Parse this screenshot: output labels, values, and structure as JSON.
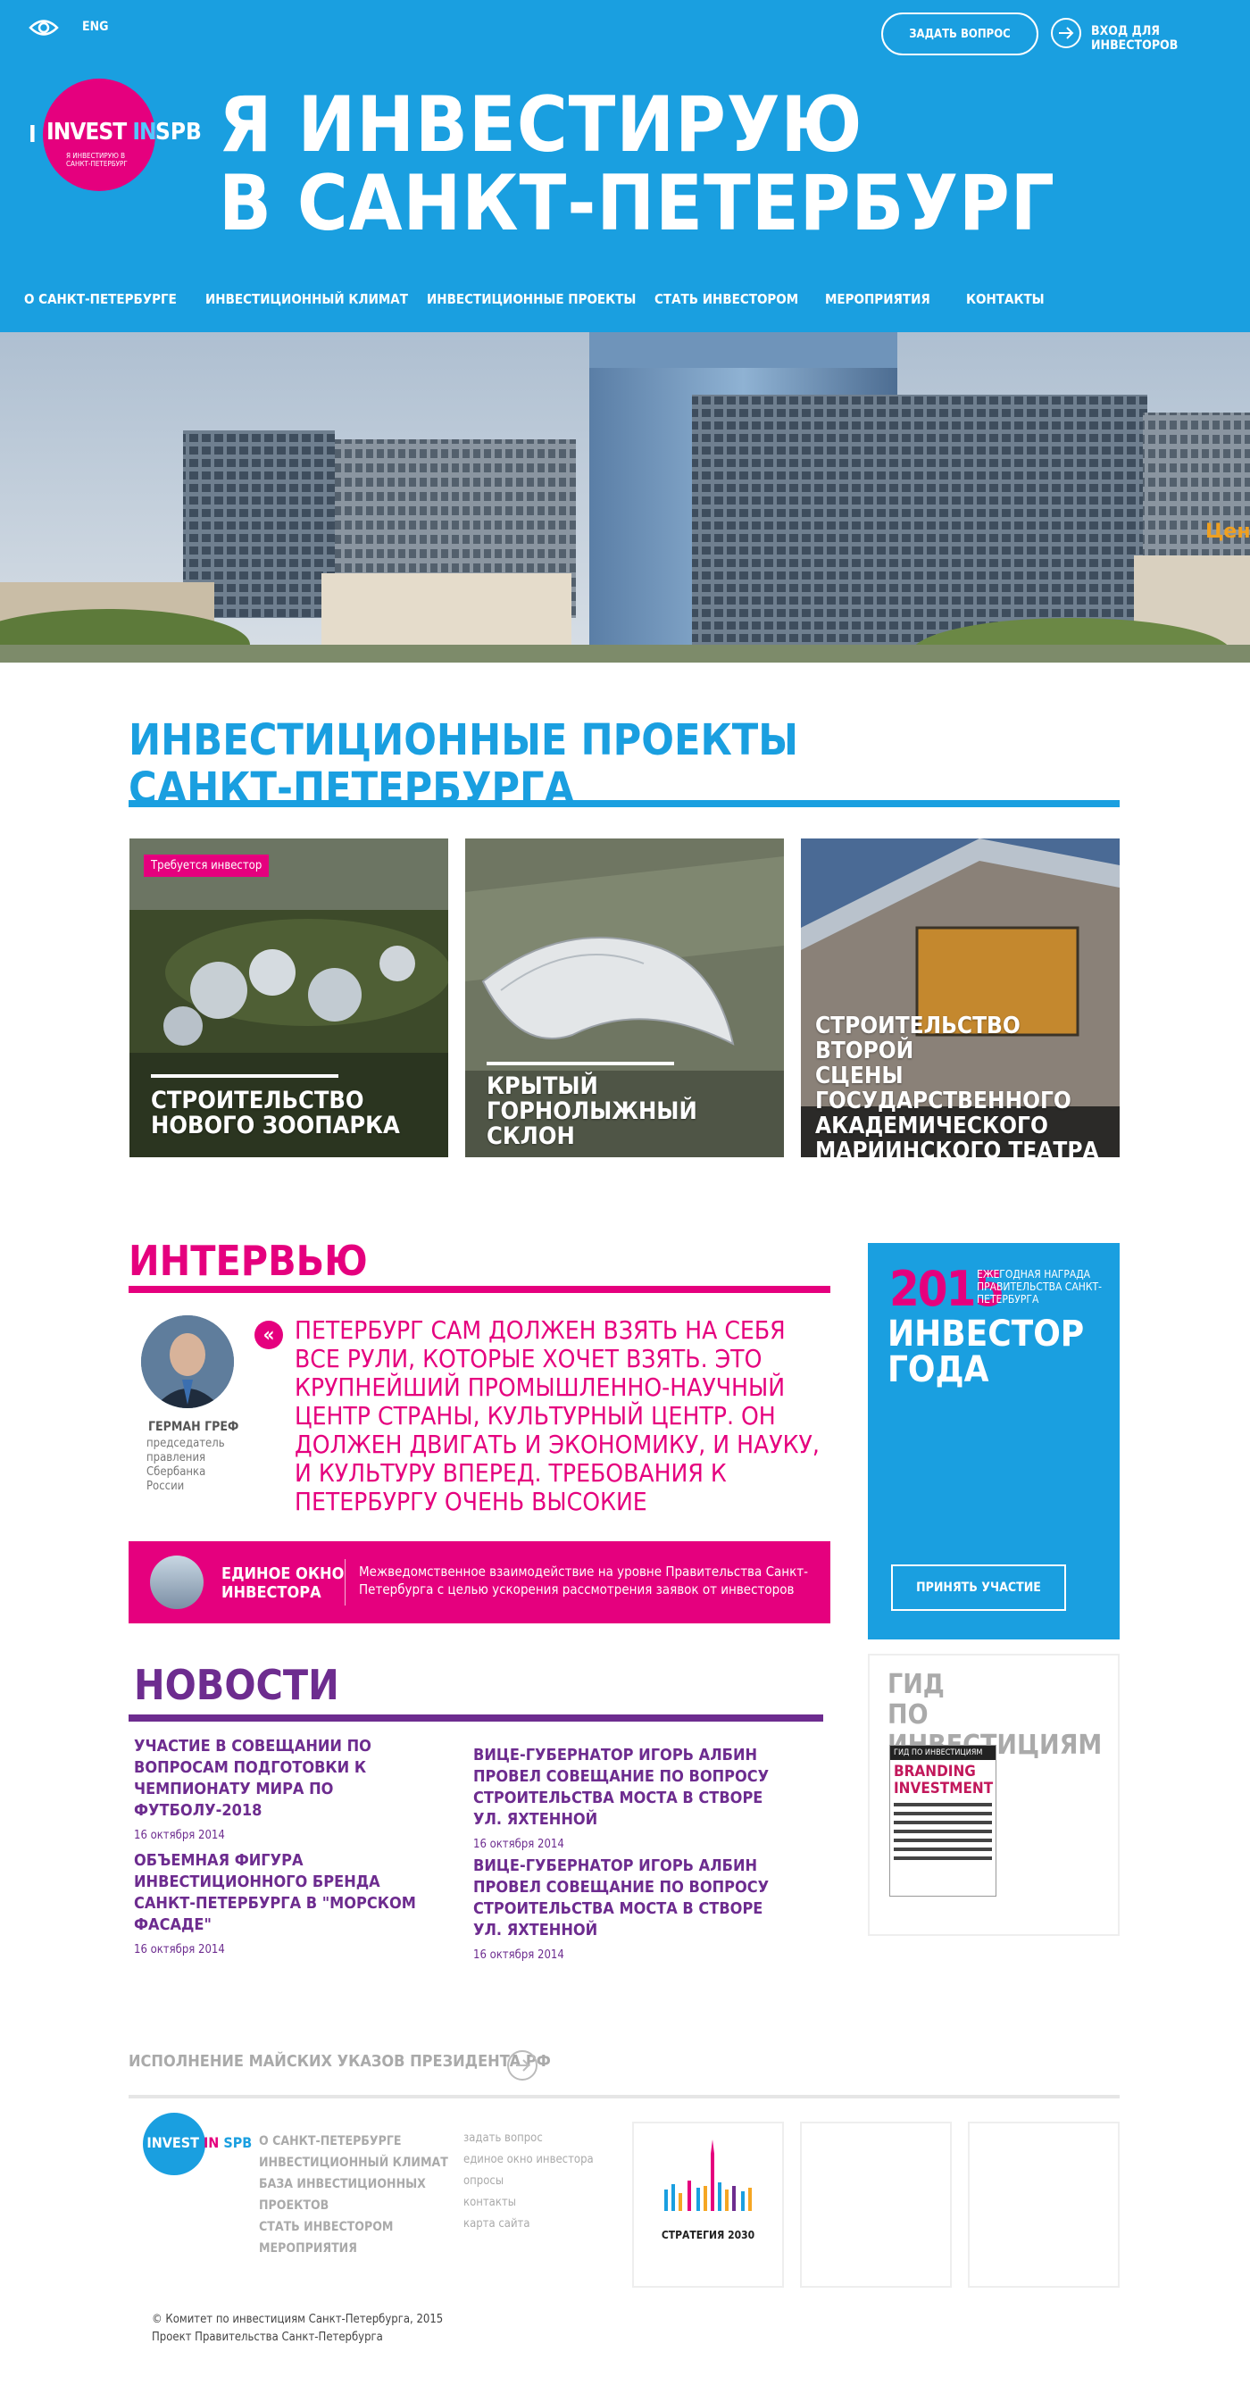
{
  "header": {
    "lang": "ENG",
    "ask_button": "ЗАДАТЬ ВОПРОС",
    "login": "ВХОД ДЛЯ ИНВЕСТОРОВ",
    "logo_i": "I",
    "logo_invest": "INVEST",
    "logo_in": "IN",
    "logo_spb": "SPB",
    "logo_sub": "Я ИНВЕСТИРУЮ В САНКТ-ПЕТЕРБУРГ",
    "title_line1": "Я ИНВЕСТИРУЮ",
    "title_line2": "В САНКТ-ПЕТЕРБУРГ"
  },
  "nav": [
    {
      "label": "О САНКТ-ПЕТЕРБУРГЕ"
    },
    {
      "label": "ИНВЕСТИЦИОННЫЙ КЛИМАТ"
    },
    {
      "label": "ИНВЕСТИЦИОННЫЕ ПРОЕКТЫ"
    },
    {
      "label": "СТАТЬ ИНВЕСТОРОМ"
    },
    {
      "label": "МЕРОПРИЯТИЯ"
    },
    {
      "label": "КОНТАКТЫ"
    }
  ],
  "banner": {
    "sign": "Цент"
  },
  "projects": {
    "title_line1": "ИНВЕСТИЦИОННЫЕ ПРОЕКТЫ",
    "title_line2": "САНКТ-ПЕТЕРБУРГА",
    "cards": [
      {
        "badge": "Требуется инвестор",
        "line1": "СТРОИТЕЛЬСТВО",
        "line2": "НОВОГО ЗООПАРКА"
      },
      {
        "line1": "КРЫТЫЙ",
        "line2": "ГОРНОЛЫЖНЫЙ",
        "line3": "СКЛОН"
      },
      {
        "line1": "СТРОИТЕЛЬСТВО ВТОРОЙ",
        "line2": "СЦЕНЫ",
        "line3": "ГОСУДАРСТВЕННОГО",
        "line4": "АКАДЕМИЧЕСКОГО",
        "line5": "МАРИИНСКОГО ТЕАТРА"
      }
    ]
  },
  "interview": {
    "title": "ИНТЕРВЬЮ",
    "quote_mark": "«",
    "quote": "ПЕТЕРБУРГ САМ ДОЛЖЕН ВЗЯТЬ НА СЕБЯ ВСЕ РУЛИ, КОТОРЫЕ ХОЧЕТ ВЗЯТЬ. ЭТО КРУПНЕЙШИЙ ПРОМЫШЛЕННО-НАУЧНЫЙ ЦЕНТР СТРАНЫ, КУЛЬТУРНЫЙ ЦЕНТР. ОН ДОЛЖЕН ДВИГАТЬ И ЭКОНОМИКУ, И НАУКУ, И КУЛЬТУРУ ВПЕРЕД. ТРЕБОВАНИЯ К ПЕТЕРБУРГУ ОЧЕНЬ ВЫСОКИЕ",
    "name": "ГЕРМАН ГРЕФ",
    "role": "председатель правления Сбербанка России"
  },
  "single_window": {
    "title_line1": "ЕДИНОЕ ОКНО",
    "title_line2": "ИНВЕСТОРА",
    "desc": "Межведомственное взаимодействие на уровне Правительства Санкт-Петербурга с целью ускорения рассмотрения заявок от инвесторов"
  },
  "award": {
    "year": "2015",
    "desc": "ЕЖЕГОДНАЯ НАГРАДА ПРАВИТЕЛЬСТВА САНКТ-ПЕТЕРБУРГА",
    "title_line1": "ИНВЕСТОР",
    "title_line2": "ГОДА",
    "button": "ПРИНЯТЬ УЧАСТИЕ"
  },
  "guide": {
    "title_line1": "ГИД",
    "title_line2": "ПО ИНВЕСТИЦИЯМ",
    "cover_top": "ГИД ПО ИНВЕСТИЦИЯМ",
    "cover_main1": "BRANDING",
    "cover_main2": "INVESTMENT"
  },
  "news": {
    "title": "НОВОСТИ",
    "items": [
      {
        "text": "УЧАСТИЕ В СОВЕЩАНИИ ПО ВОПРОСАМ ПОДГОТОВКИ К ЧЕМПИОНАТУ МИРА ПО ФУТБОЛУ-2018",
        "date": "16 октября 2014"
      },
      {
        "text": "ВИЦЕ-ГУБЕРНАТОР ИГОРЬ АЛБИН ПРОВЕЛ СОВЕЩАНИЕ ПО ВОПРОСУ СТРОИТЕЛЬСТВА МОСТА В СТВОРЕ УЛ. ЯХТЕННОЙ",
        "date": "16 октября 2014"
      },
      {
        "text": "ОБЪЕМНАЯ ФИГУРА ИНВЕСТИЦИОННОГО БРЕНДА САНКТ-ПЕТЕРБУРГА В \"МОРСКОМ ФАСАДЕ\"",
        "date": "16 октября 2014"
      },
      {
        "text": "ВИЦЕ-ГУБЕРНАТОР ИГОРЬ АЛБИН ПРОВЕЛ СОВЕЩАНИЕ ПО ВОПРОСУ СТРОИТЕЛЬСТВА МОСТА В СТВОРЕ УЛ. ЯХТЕННОЙ",
        "date": "16 октября 2014"
      }
    ]
  },
  "footer": {
    "decrees": "ИСПОЛНЕНИЕ МАЙСКИХ УКАЗОВ ПРЕЗИДЕНТА РФ",
    "nav": [
      "О САНКТ-ПЕТЕРБУРГЕ",
      "ИНВЕСТИЦИОННЫЙ КЛИМАТ",
      "БАЗА ИНВЕСТИЦИОННЫХ",
      "ПРОЕКТОВ",
      "СТАТЬ ИНВЕСТОРОМ",
      "МЕРОПРИЯТИЯ"
    ],
    "links": [
      "задать вопрос",
      "единое окно инвестора",
      "опросы",
      "контакты",
      "карта сайта"
    ],
    "strategy": "СТРАТЕГИЯ 2030",
    "copyright1": "© Комитет по инвестициям Санкт-Петербурга, 2015",
    "copyright2": "Проект Правительства Санкт-Петербурга"
  },
  "colors": {
    "blue": "#1a9fe0",
    "pink": "#e5007e",
    "purple": "#6d2c8f",
    "gray": "#aaaaaa"
  }
}
